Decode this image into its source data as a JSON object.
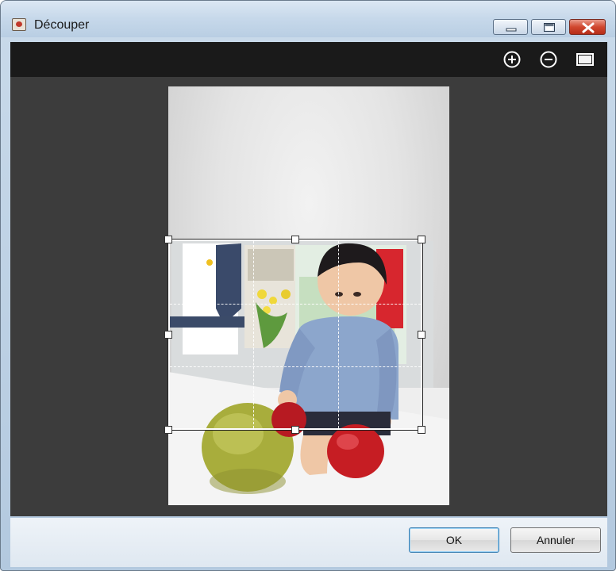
{
  "window": {
    "title": "Découper",
    "icon": "crop-app-icon",
    "controls": [
      "minimize-icon",
      "maximize-icon",
      "close-icon"
    ]
  },
  "toolbar": {
    "items": [
      {
        "name": "zoom-in",
        "icon": "plus-circle-icon"
      },
      {
        "name": "zoom-out",
        "icon": "minus-circle-icon"
      },
      {
        "name": "fit",
        "icon": "rectangle-icon"
      }
    ]
  },
  "footer": {
    "ok_label": "OK",
    "cancel_label": "Annuler"
  },
  "colors": {
    "canvas_bg": "#3c3c3c",
    "toolbar_bg": "#1a1a1a",
    "close_button": "#c53a22"
  }
}
